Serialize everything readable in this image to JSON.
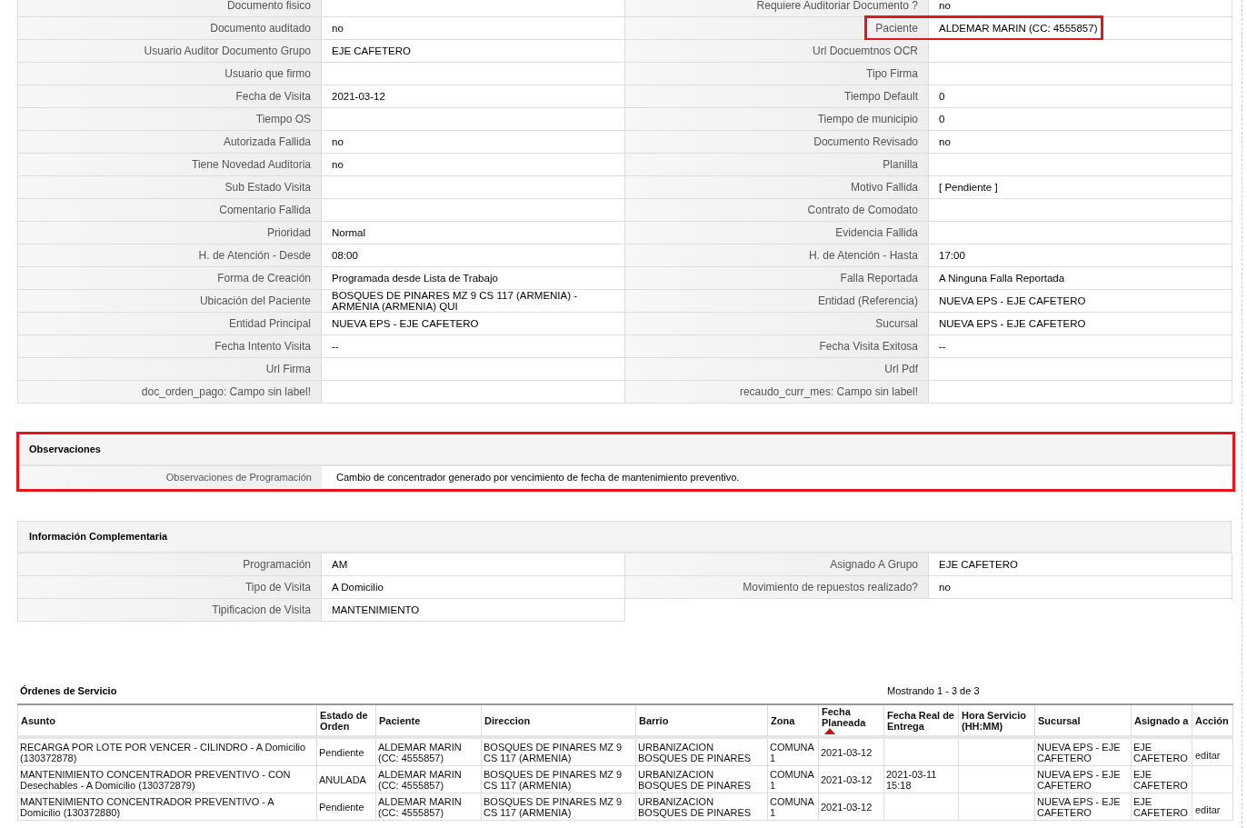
{
  "detail_fields": [
    {
      "left": {
        "label": "Documento fisico"
      },
      "right": {
        "label": "Requiere Auditoriar Documento ?",
        "value": "no"
      }
    },
    {
      "left": {
        "label": "Documento auditado",
        "value": "no"
      },
      "right": {
        "label": "Paciente",
        "value": "ALDEMAR MARIN (CC: 4555857)",
        "highlighted": true
      }
    },
    {
      "left": {
        "label": "Usuario Auditor Documento Grupo",
        "value": "EJE CAFETERO"
      },
      "right": {
        "label": "Url Docuemtnos OCR"
      }
    },
    {
      "left": {
        "label": "Usuario que firmo"
      },
      "right": {
        "label": "Tipo Firma"
      }
    },
    {
      "left": {
        "label": "Fecha de Visita",
        "value": "2021-03-12"
      },
      "right": {
        "label": "Tiempo Default",
        "value": "0"
      }
    },
    {
      "left": {
        "label": "Tiempo OS"
      },
      "right": {
        "label": "Tiempo de municipio",
        "value": "0"
      }
    },
    {
      "left": {
        "label": "Autorizada Fallida",
        "value": "no"
      },
      "right": {
        "label": "Documento Revisado",
        "value": "no"
      }
    },
    {
      "left": {
        "label": "Tiene Novedad Auditoria",
        "value": "no"
      },
      "right": {
        "label": "Planilla"
      }
    },
    {
      "left": {
        "label": "Sub Estado Visita"
      },
      "right": {
        "label": "Motivo Fallida",
        "value": "[ Pendiente ]"
      }
    },
    {
      "left": {
        "label": "Comentario Fallida"
      },
      "right": {
        "label": "Contrato de Comodato"
      }
    },
    {
      "left": {
        "label": "Prioridad",
        "value": "Normal"
      },
      "right": {
        "label": "Evidencia Fallida"
      }
    },
    {
      "left": {
        "label": "H. de Atención - Desde",
        "value": "08:00"
      },
      "right": {
        "label": "H. de Atención - Hasta",
        "value": "17:00"
      }
    },
    {
      "left": {
        "label": "Forma de Creación",
        "value": "Programada desde Lista de Trabajo"
      },
      "right": {
        "label": "Falla Reportada",
        "value": "A Ninguna Falla Reportada"
      }
    },
    {
      "left": {
        "label": "Ubicación del Paciente",
        "value": "BOSQUES DE PINARES MZ 9 CS 117 (ARMENIA) - ARMENIA (ARMENIA) QUI"
      },
      "right": {
        "label": "Entidad (Referencia)",
        "value": "NUEVA EPS - EJE CAFETERO"
      }
    },
    {
      "left": {
        "label": "Entidad Principal",
        "value": "NUEVA EPS - EJE CAFETERO"
      },
      "right": {
        "label": "Sucursal",
        "value": "NUEVA EPS - EJE CAFETERO"
      }
    },
    {
      "left": {
        "label": "Fecha Intento Visita",
        "value": "--"
      },
      "right": {
        "label": "Fecha Visita Exitosa",
        "value": "--"
      }
    },
    {
      "left": {
        "label": "Url Firma"
      },
      "right": {
        "label": "Url Pdf"
      }
    },
    {
      "left": {
        "label": "doc_orden_pago: Campo sin label!"
      },
      "right": {
        "label": "recaudo_curr_mes: Campo sin label!"
      }
    }
  ],
  "observaciones": {
    "title": "Observaciones",
    "highlighted": true,
    "label": "Observaciones de Programación",
    "value": "Cambio de concentrador generado por vencimiento de fecha de mantenimiento preventivo."
  },
  "informacion_complementaria": {
    "title": "Información Complementaria",
    "rows": [
      {
        "left": {
          "label": "Programación",
          "value": "AM"
        },
        "right": {
          "label": "Asignado A Grupo",
          "value": "EJE CAFETERO"
        }
      },
      {
        "left": {
          "label": "Tipo de Visita",
          "value": "A Domicilio"
        },
        "right": {
          "label": "Movimiento de repuestos realizado?",
          "value": "no"
        }
      },
      {
        "left": {
          "label": "Tipificacion de Visita",
          "value": "MANTENIMIENTO"
        }
      }
    ]
  },
  "ordenes": {
    "title": "Órdenes de Servicio",
    "paging": "Mostrando 1 - 3 de 3",
    "columns": [
      {
        "label": "Asunto",
        "sorted": false
      },
      {
        "label": "Estado de Orden",
        "sorted": false
      },
      {
        "label": "Paciente",
        "sorted": false
      },
      {
        "label": "Direccion",
        "sorted": false
      },
      {
        "label": "Barrio",
        "sorted": false
      },
      {
        "label": "Zona",
        "sorted": false
      },
      {
        "label": "Fecha Planeada",
        "sorted": true
      },
      {
        "label": "Fecha Real de Entrega",
        "sorted": false
      },
      {
        "label": "Hora Servicio (HH:MM)",
        "sorted": false
      },
      {
        "label": "Sucursal",
        "sorted": false
      },
      {
        "label": "Asignado a",
        "sorted": false
      },
      {
        "label": "Acción",
        "sorted": false
      }
    ],
    "rows": [
      {
        "cells": [
          "RECARGA POR LOTE POR VENCER - CILINDRO - A Domicilio (130372878)",
          "Pendiente",
          "ALDEMAR MARIN (CC: 4555857)",
          "BOSQUES DE PINARES MZ 9 CS 117 (ARMENIA)",
          "URBANIZACION BOSQUES DE PINARES",
          "COMUNA 1",
          "2021-03-12",
          null,
          null,
          "NUEVA EPS - EJE CAFETERO",
          "EJE CAFETERO"
        ],
        "action": "editar"
      },
      {
        "cells": [
          "MANTENIMIENTO CONCENTRADOR PREVENTIVO - CON Desechables - A Domicilio (130372879)",
          "ANULADA",
          "ALDEMAR MARIN (CC: 4555857)",
          "BOSQUES DE PINARES MZ 9 CS 117 (ARMENIA)",
          "URBANIZACION BOSQUES DE PINARES",
          "COMUNA 1",
          "2021-03-12",
          "2021-03-11 15:18",
          null,
          "NUEVA EPS - EJE CAFETERO",
          "EJE CAFETERO"
        ]
      },
      {
        "cells": [
          "MANTENIMIENTO CONCENTRADOR PREVENTIVO - A Domicilio (130372880)",
          "Pendiente",
          "ALDEMAR MARIN (CC: 4555857)",
          "BOSQUES DE PINARES MZ 9 CS 117 (ARMENIA)",
          "URBANIZACION BOSQUES DE PINARES",
          "COMUNA 1",
          "2021-03-12",
          null,
          null,
          "NUEVA EPS - EJE CAFETERO",
          "EJE CAFETERO"
        ],
        "action": "editar"
      }
    ]
  }
}
